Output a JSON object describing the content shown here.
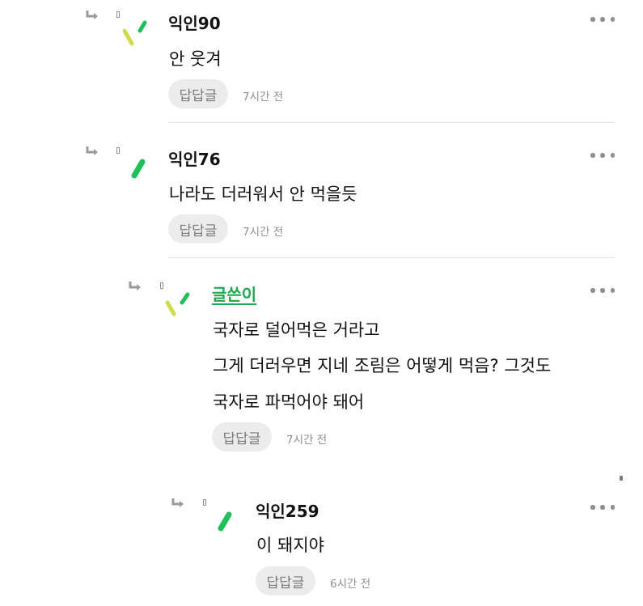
{
  "comments": [
    {
      "author": "익인90",
      "lines": [
        "안 웃겨"
      ],
      "reply_label": "답답글",
      "time": "7시간 전",
      "avatar_icon": "double-dash-avatar-icon"
    },
    {
      "author": "익인76",
      "lines": [
        "나라도 더러워서 안 먹을듯"
      ],
      "reply_label": "답답글",
      "time": "7시간 전",
      "avatar_icon": "single-dash-avatar-icon"
    },
    {
      "author": "글쓴이",
      "lines": [
        "국자로 덜어먹은 거라고",
        "그게 더러우면 지네 조림은 어떻게 먹음? 그것도",
        "국자로 파먹어야 돼어"
      ],
      "reply_label": "답답글",
      "time": "7시간 전",
      "avatar_icon": "double-dash-avatar-icon"
    },
    {
      "author": "익인259",
      "lines": [
        "이 돼지야"
      ],
      "reply_label": "답답글",
      "time": "6시간 전",
      "avatar_icon": "single-dash-avatar-icon"
    }
  ],
  "colors": {
    "author_op": "#1fa84f",
    "avatar_green": "#1fbf5a",
    "avatar_yellow": "#c8d84a",
    "reply_button_bg": "#ececec"
  }
}
